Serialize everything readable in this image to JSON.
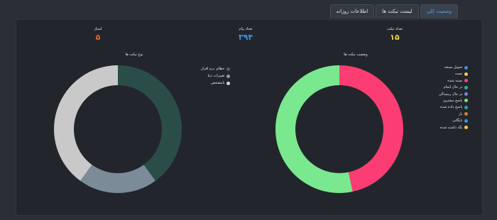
{
  "tabs": [
    {
      "label": "وضعیت کلی",
      "active": true
    },
    {
      "label": "لیست تیکت ها",
      "active": false
    },
    {
      "label": "اطلاعات روزانه",
      "active": false
    }
  ],
  "stats": {
    "tickets": {
      "label": "تعداد تیکت",
      "value": "۱۵",
      "color": "#e7d34a"
    },
    "messages": {
      "label": "تعداد پیام",
      "value": "۳۹۴",
      "color": "#3f8fe0"
    },
    "score": {
      "label": "امتیاز",
      "value": "۵",
      "color": "#e2672e"
    }
  },
  "chart_data": [
    {
      "type": "pie",
      "title": "وضعیت تیکت ها",
      "legend": [
        {
          "label": "تحویل نسخه",
          "color": "#3f8fe0"
        },
        {
          "label": "تست",
          "color": "#f2c94c"
        },
        {
          "label": "بسته شده",
          "color": "#f0467a"
        },
        {
          "label": "در حال انجام",
          "color": "#2fb589"
        },
        {
          "label": "در حال رسیدگی",
          "color": "#7b7ff0"
        },
        {
          "label": "پاسخ مشتری",
          "color": "#7ee07e"
        },
        {
          "label": "پاسخ داده شده",
          "color": "#2aa0a8"
        },
        {
          "label": "باز",
          "color": "#e07a2e"
        },
        {
          "label": "بایگانی",
          "color": "#3f8fe0"
        },
        {
          "label": "نگه داشته شده",
          "color": "#f2c94c"
        }
      ],
      "slices": [
        {
          "label": "بسته شده",
          "value": 7,
          "color": "#fb3d74"
        },
        {
          "label": "پاسخ مشتری",
          "value": 8,
          "color": "#7ae88e"
        }
      ]
    },
    {
      "type": "pie",
      "title": "نوع تیکت ها",
      "legend": [
        {
          "label": "خطای نرم افزار",
          "color": "#555b63"
        },
        {
          "label": "تغییرات دیتا",
          "color": "#8e9aa4"
        },
        {
          "label": "نامشخص",
          "color": "#cfd2d5"
        }
      ],
      "slices": [
        {
          "label": "خطای نرم افزار",
          "value": 6,
          "color": "#2b4d47"
        },
        {
          "label": "تغییرات دیتا",
          "value": 3,
          "color": "#7b8b97"
        },
        {
          "label": "نامشخص",
          "value": 6,
          "color": "#c9c9c9"
        }
      ]
    }
  ]
}
